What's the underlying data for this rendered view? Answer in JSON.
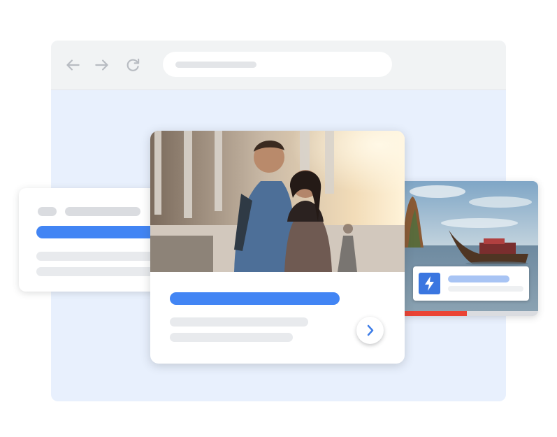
{
  "browser": {
    "icons": {
      "back": "arrow-back-icon",
      "forward": "arrow-forward-icon",
      "reload": "reload-icon"
    },
    "address_bar": {
      "value": ""
    }
  },
  "main_card": {
    "image": "couple-at-temple-photo",
    "action_icon": "chevron-right-icon"
  },
  "side_card": {
    "image": "longtail-boat-lagoon-photo",
    "badge_icon": "lightning-bolt-icon",
    "progress": 0.5
  },
  "colors": {
    "accent_blue": "#4285f4",
    "progress_red": "#ea4335",
    "placeholder_gray": "#e8eaed",
    "window_background": "#e8f0fd"
  }
}
